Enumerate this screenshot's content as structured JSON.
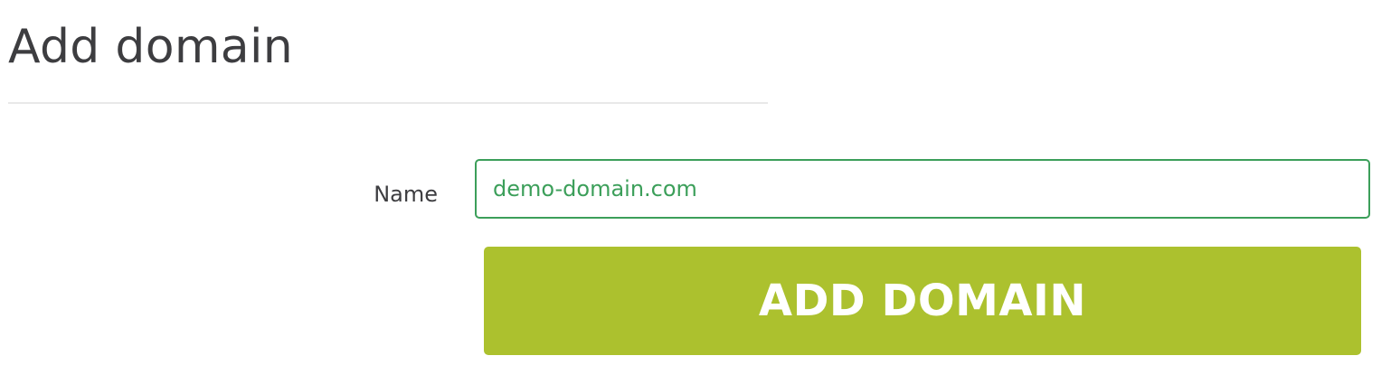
{
  "page": {
    "title": "Add domain"
  },
  "form": {
    "name_label": "Name",
    "name_value": "demo-domain.com",
    "submit_label": "ADD DOMAIN"
  },
  "colors": {
    "accent_green": "#3c9f5a",
    "button_lime": "#acc12e",
    "text_dark": "#3d3d40"
  }
}
